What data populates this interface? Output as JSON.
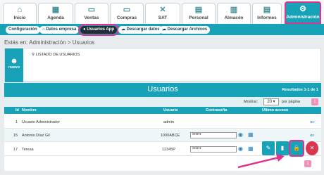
{
  "nav": {
    "tabs": [
      {
        "label": "Inicio",
        "icon": "home-icon"
      },
      {
        "label": "Agenda",
        "icon": "calendar-icon"
      },
      {
        "label": "Ventas",
        "icon": "cash-icon"
      },
      {
        "label": "Compras",
        "icon": "cash-minus-icon"
      },
      {
        "label": "SAT",
        "icon": "tools-icon"
      },
      {
        "label": "Personal",
        "icon": "person-card-icon"
      },
      {
        "label": "Almacén",
        "icon": "warehouse-icon"
      },
      {
        "label": "Informes",
        "icon": "chart-icon"
      },
      {
        "label": "Administración",
        "icon": "gears-icon"
      }
    ],
    "active_index": 8
  },
  "subnav": {
    "items": [
      {
        "label": "Configuración"
      },
      {
        "label": "Datos empresa"
      },
      {
        "label": "Usuarios App"
      },
      {
        "label": "Descargar datos"
      },
      {
        "label": "Descargar Archivos"
      }
    ],
    "active_index": 2
  },
  "breadcrumb": "Estás en: Administración > Usuarios",
  "panel": {
    "new_label": "nuevo",
    "list_link": "LISTADO DE USUARIOS"
  },
  "table": {
    "title": "Usuarios",
    "results": "Resultados 1-1 de 1",
    "show_label": "Mostrar:",
    "page_size": "20",
    "per_page_label": "por página",
    "page": "1",
    "columns": [
      "Id",
      "Nombre",
      "Usuario",
      "Contraseña",
      "Último acceso"
    ],
    "rows": [
      {
        "id": "1",
        "name": "Usuario Administrador",
        "user": "admin",
        "password": "",
        "has_password": false
      },
      {
        "id": "15",
        "name": "Antonio Díaz Gil",
        "user": "1000ABCE",
        "password": "••••••",
        "has_password": true
      },
      {
        "id": "17",
        "name": "Teresa",
        "user": "12345P",
        "password": "••••••",
        "has_password": true
      }
    ]
  },
  "colors": {
    "accent": "#17a2b8",
    "highlight": "#e0338d",
    "danger": "#d9374f"
  }
}
